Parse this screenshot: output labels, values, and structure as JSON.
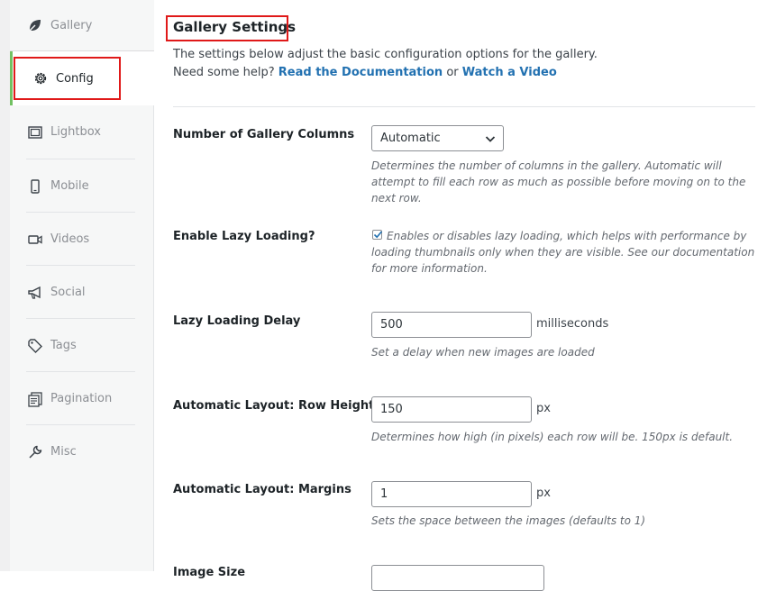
{
  "sidebar": {
    "items": [
      {
        "label": "Gallery",
        "icon": "leaf-icon"
      },
      {
        "label": "Config",
        "icon": "gear-icon"
      },
      {
        "label": "Lightbox",
        "icon": "lightbox-icon"
      },
      {
        "label": "Mobile",
        "icon": "mobile-icon"
      },
      {
        "label": "Videos",
        "icon": "video-icon"
      },
      {
        "label": "Social",
        "icon": "megaphone-icon"
      },
      {
        "label": "Tags",
        "icon": "tag-icon"
      },
      {
        "label": "Pagination",
        "icon": "pagination-icon"
      },
      {
        "label": "Misc",
        "icon": "wrench-icon"
      }
    ],
    "active": "Config",
    "accent_color": "#72c163"
  },
  "main": {
    "title": "Gallery Settings",
    "intro_line1": "The settings below adjust the basic configuration options for the gallery.",
    "intro_help": "Need some help?",
    "doc_link": "Read the Documentation",
    "or_text": "or",
    "video_link": "Watch a Video",
    "link_color": "#2271b1",
    "highlight_color": "#e01919"
  },
  "settings": {
    "columns": {
      "label": "Number of Gallery Columns",
      "value": "Automatic",
      "description": "Determines the number of columns in the gallery. Automatic will attempt to fill each row as much as possible before moving on to the next row."
    },
    "lazy": {
      "label": "Enable Lazy Loading?",
      "checked": true,
      "description": "Enables or disables lazy loading, which helps with performance by loading thumbnails only when they are visible. See our documentation for more information."
    },
    "lazy_delay": {
      "label": "Lazy Loading Delay",
      "value": "500",
      "unit": "milliseconds",
      "description": "Set a delay when new images are loaded"
    },
    "row_height": {
      "label": "Automatic Layout: Row Height",
      "value": "150",
      "unit": "px",
      "description": "Determines how high (in pixels) each row will be. 150px is default."
    },
    "margins": {
      "label": "Automatic Layout: Margins",
      "value": "1",
      "unit": "px",
      "description": "Sets the space between the images (defaults to 1)"
    },
    "next_label": "Image Size"
  }
}
